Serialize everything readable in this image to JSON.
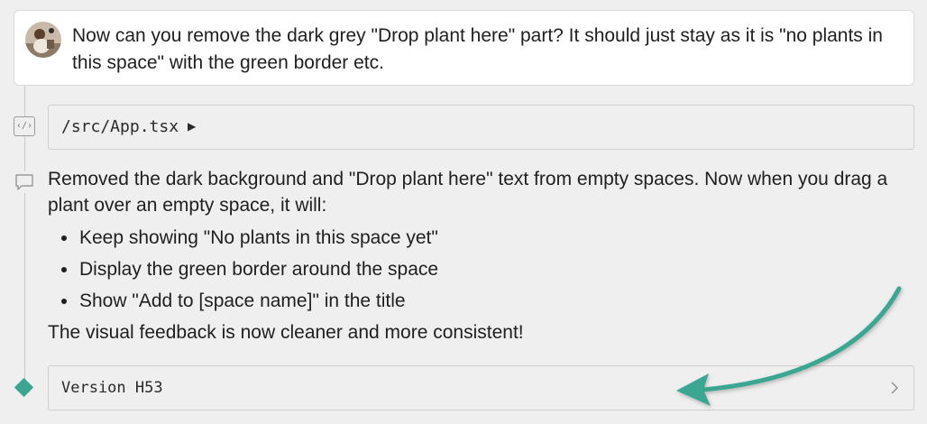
{
  "user_message": {
    "text": "Now can you remove the dark grey \"Drop plant here\" part? It should just stay as it is \"no plants in this space\" with the green border etc."
  },
  "file_change": {
    "path": "/src/App.tsx",
    "expand_glyph": "▶"
  },
  "assistant_reply": {
    "intro": "Removed the dark background and \"Drop plant here\" text from empty spaces. Now when you drag a plant over an empty space, it will:",
    "bullets": [
      "Keep showing \"No plants in this space yet\"",
      "Display the green border around the space",
      "Show \"Add to [space name]\" in the title"
    ],
    "closing": "The visual feedback is now cleaner and more consistent!"
  },
  "version": {
    "label": "Version H53"
  },
  "colors": {
    "accent": "#3aa692",
    "background": "#efefef",
    "card": "#ffffff"
  },
  "icons": {
    "code": "code-brackets-icon",
    "chat": "chat-bubble-icon",
    "version": "diamond-icon",
    "open": "chevron-right-icon"
  }
}
